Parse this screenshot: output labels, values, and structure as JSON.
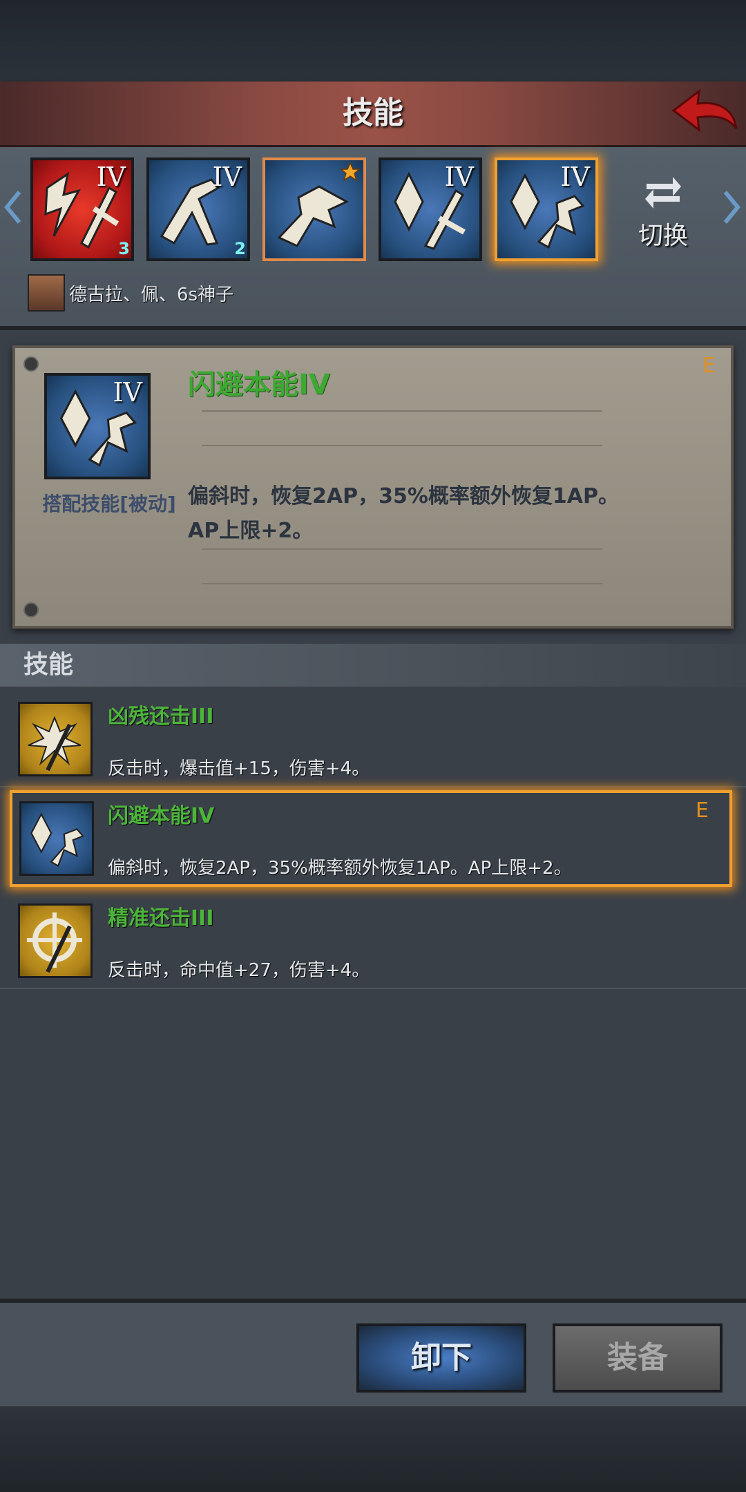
{
  "header": {
    "title": "技能",
    "back_icon": "back-arrow-icon"
  },
  "equipped_slots": [
    {
      "icon": "strike-counter-icon",
      "level": "IV",
      "gem": "3"
    },
    {
      "icon": "mantis-strike-icon",
      "level": "IV",
      "gem": "2"
    },
    {
      "icon": "dash-attack-icon",
      "level": "",
      "star": true
    },
    {
      "icon": "crystal-sword-icon",
      "level": "IV"
    },
    {
      "icon": "crystal-dodge-icon",
      "level": "IV"
    }
  ],
  "swap": {
    "label": "切换",
    "icon": "swap-arrows-icon"
  },
  "character": {
    "names": "德古拉、佩、6s神子"
  },
  "detail": {
    "title": "闪避本能IV",
    "grade": "E",
    "type": "搭配技能[被动]",
    "level": "IV",
    "desc_line1": "偏斜时，恢复2AP，35%概率额外恢复1AP。",
    "desc_line2": "AP上限+2。"
  },
  "section": {
    "title": "技能"
  },
  "skills": [
    {
      "name": "凶残还击III",
      "desc": "反击时，爆击值+15，伤害+4。",
      "icon": "brutal-counter-icon",
      "grade": ""
    },
    {
      "name": "闪避本能IV",
      "desc": "偏斜时，恢复2AP，35%概率额外恢复1AP。AP上限+2。",
      "icon": "crystal-dodge-icon",
      "grade": "E"
    },
    {
      "name": "精准还击III",
      "desc": "反击时，命中值+27，伤害+4。",
      "icon": "precise-counter-icon",
      "grade": ""
    }
  ],
  "buttons": {
    "unload": "卸下",
    "equip": "装备"
  },
  "colors": {
    "accent_green": "#4cb43a",
    "grade_orange": "#e09020",
    "selection": "#f0a030"
  }
}
